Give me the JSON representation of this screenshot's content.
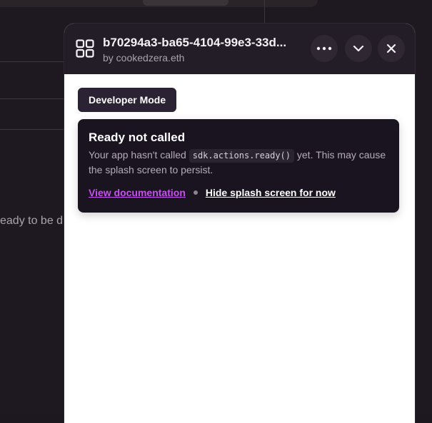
{
  "background": {
    "partial_text": "eady to be d"
  },
  "header": {
    "app_icon": "grid-icon",
    "title": "b70294a3-ba65-4104-99e3-33d...",
    "subtitle": "by cookedzera.eth",
    "buttons": [
      {
        "icon": "more-horizontal-icon"
      },
      {
        "icon": "chevron-down-icon"
      },
      {
        "icon": "close-icon"
      }
    ]
  },
  "badge": {
    "label": "Developer Mode"
  },
  "notice": {
    "title": "Ready not called",
    "body_prefix": "Your app hasn't called ",
    "code": "sdk.actions.ready()",
    "body_suffix": " yet. This may cause the splash screen to persist.",
    "link_docs": "View documentation",
    "link_hide": "Hide splash screen for now"
  },
  "colors": {
    "header_bg": "#231d27",
    "accent_link": "#c750f0",
    "card_bg": "#1a1420",
    "badge_bg": "#2b2233"
  }
}
